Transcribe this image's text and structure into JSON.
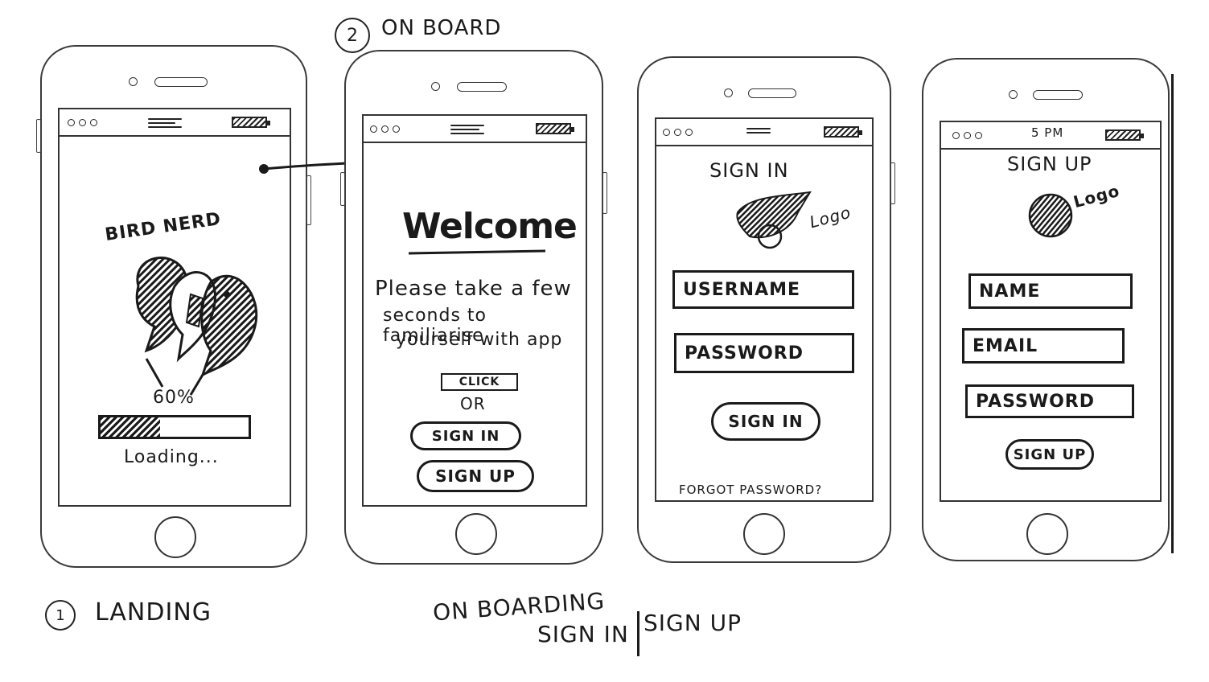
{
  "annotations": {
    "step2_number": "2",
    "step2_label": "ON BOARD",
    "step1_number": "1",
    "step1_label": "LANDING",
    "caption_line1": "ON BOARDING",
    "caption_line2_left": "SIGN IN",
    "caption_line2_right": "SIGN UP"
  },
  "landing": {
    "logo_text": "BIRD NERD",
    "progress_label": "60%",
    "progress_value": 0.4,
    "loading_text": "Loading..."
  },
  "onboard": {
    "welcome": "Welcome",
    "message_line1": "Please take a few",
    "message_line2": "seconds to familiarise",
    "message_line3": "yourself with app",
    "click_label": "CLICK",
    "or_label": "OR",
    "signin_button": "SIGN IN",
    "signup_button": "SIGN UP"
  },
  "signin": {
    "title": "SIGN IN",
    "logo_label": "Logo",
    "username_field": "USERNAME",
    "password_field": "PASSWORD",
    "signin_button": "SIGN IN",
    "forgot_password": "FORGOT PASSWORD?"
  },
  "signup": {
    "status_time": "5 PM",
    "title": "SIGN UP",
    "logo_label": "Logo",
    "name_field": "NAME",
    "email_field": "EMAIL",
    "password_field": "PASSWORD",
    "signup_button": "SIGN UP"
  }
}
